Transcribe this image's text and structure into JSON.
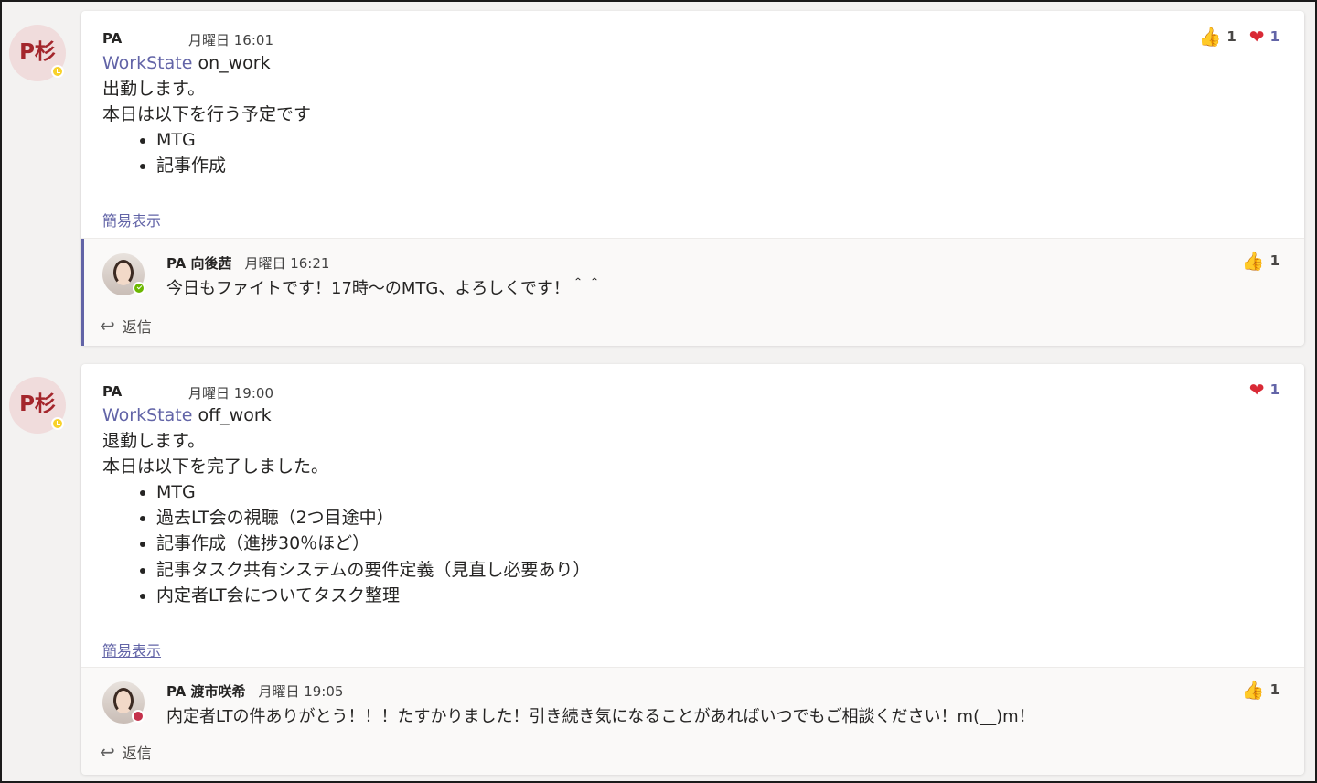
{
  "posts": [
    {
      "avatar_initials": "P杉",
      "sender": "PA",
      "time": "月曜日 16:01",
      "workstate_label": "WorkState",
      "workstate_value": " on_work",
      "line1": "出勤します。",
      "line2": "本日は以下を行う予定です",
      "bullets": [
        "MTG",
        "記事作成"
      ],
      "show_less": "簡易表示",
      "reactions": {
        "like_icon": "thumbs-up",
        "like_count": "1",
        "heart_icon": "heart",
        "heart_count": "1"
      },
      "reply": {
        "sender": "PA 向後茜",
        "time": "月曜日 16:21",
        "text": "今日もファイトです！17時～のMTG、よろしくです！＾＾",
        "like_count": "1"
      },
      "reply_button": "返信"
    },
    {
      "avatar_initials": "P杉",
      "sender": "PA",
      "time": "月曜日 19:00",
      "workstate_label": "WorkState",
      "workstate_value": " off_work",
      "line1": "退勤します。",
      "line2": "本日は以下を完了しました。",
      "bullets": [
        "MTG",
        "過去LT会の視聴（2つ目途中）",
        "記事作成（進捗30％ほど）",
        "記事タスク共有システムの要件定義（見直し必要あり）",
        "内定者LT会についてタスク整理"
      ],
      "show_less": "簡易表示",
      "reactions": {
        "heart_icon": "heart",
        "heart_count": "1"
      },
      "reply": {
        "sender": "PA 渡市咲希",
        "time": "月曜日 19:05",
        "text": "内定者LTの件ありがとう！！！たすかりました！引き続き気になることがあればいつでもご相談ください！m(__)m！",
        "like_count": "1"
      },
      "reply_button": "返信"
    }
  ],
  "colors": {
    "accent": "#6264a7",
    "heart": "#d92a36",
    "like": "#e9a22a",
    "away": "#f8d22a",
    "available": "#6bb700",
    "busy": "#c4314b"
  }
}
